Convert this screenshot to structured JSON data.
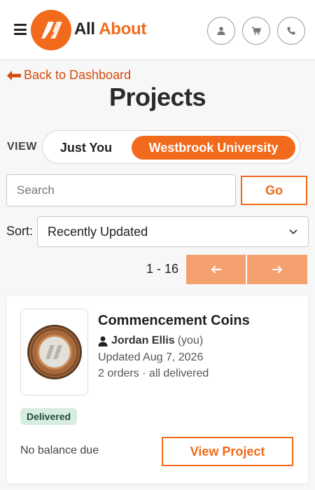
{
  "header": {
    "brand_word1": "All",
    "brand_word2": "About",
    "icons": [
      "menu-icon",
      "user-icon",
      "cart-icon",
      "phone-icon"
    ],
    "accent_color": "#f26a1b"
  },
  "nav": {
    "back_label": "Back to Dashboard"
  },
  "page": {
    "title": "Projects"
  },
  "view_toggle": {
    "label": "VIEW",
    "options": [
      "Just You",
      "Westbrook University"
    ],
    "selected": "Westbrook University"
  },
  "search": {
    "placeholder": "Search",
    "value": "",
    "button_label": "Go"
  },
  "sort": {
    "label": "Sort:",
    "selected": "Recently Updated"
  },
  "pagination": {
    "range": "1 - 16"
  },
  "projects": [
    {
      "title": "Commencement Coins",
      "owner_name": "Jordan Ellis",
      "owner_suffix": "(you)",
      "updated": "Updated Aug 7, 2026",
      "orders": "2 orders · all delivered",
      "status": "Delivered",
      "balance": "No balance due",
      "action_label": "View Project"
    }
  ]
}
